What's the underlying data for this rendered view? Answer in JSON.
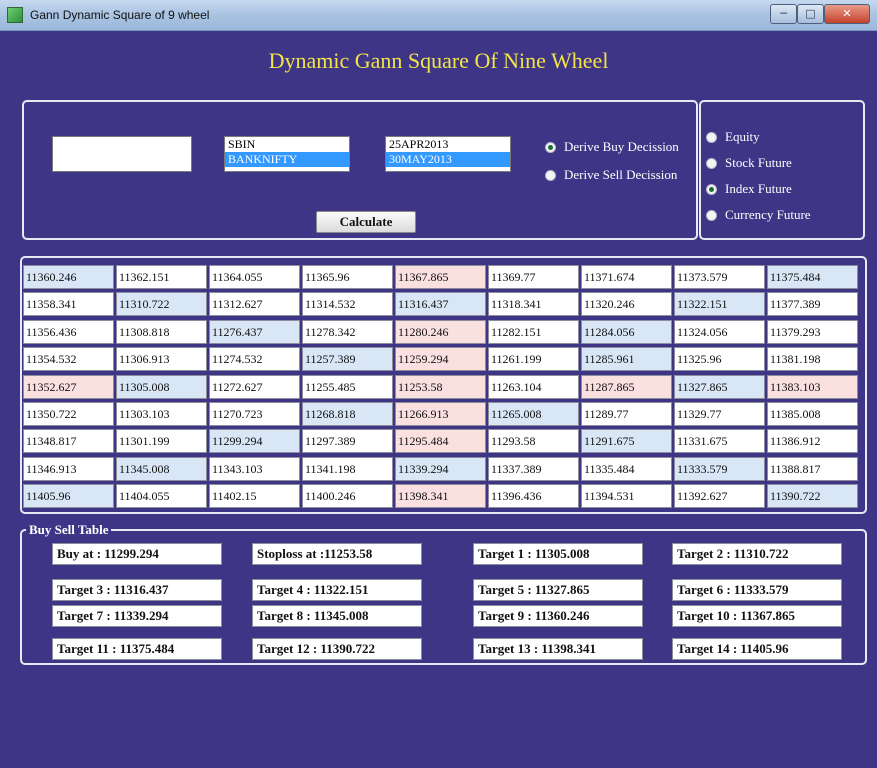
{
  "window": {
    "title": "Gann Dynamic Square of  9 wheel",
    "minimize": "─",
    "maximize": "□",
    "close": "✕",
    "icon": "app-icon"
  },
  "heading": "Dynamic Gann Square Of Nine Wheel",
  "inputs": {
    "value_input": ""
  },
  "symbols": [
    "SBIN",
    "BANKNIFTY"
  ],
  "dates": [
    "25APR2013",
    "30MAY2013"
  ],
  "decision": {
    "buy": "Derive Buy Decission",
    "sell": "Derive Sell Decission",
    "selected": "buy"
  },
  "calculate_label": "Calculate",
  "types": {
    "equity": "Equity",
    "stock_future": "Stock Future",
    "index_future": "Index Future",
    "currency_future": "Currency Future",
    "selected": "index_future"
  },
  "grid": [
    [
      "11360.246",
      "11362.151",
      "11364.055",
      "11365.96",
      "11367.865",
      "11369.77",
      "11371.674",
      "11373.579",
      "11375.484"
    ],
    [
      "11358.341",
      "11310.722",
      "11312.627",
      "11314.532",
      "11316.437",
      "11318.341",
      "11320.246",
      "11322.151",
      "11377.389"
    ],
    [
      "11356.436",
      "11308.818",
      "11276.437",
      "11278.342",
      "11280.246",
      "11282.151",
      "11284.056",
      "11324.056",
      "11379.293"
    ],
    [
      "11354.532",
      "11306.913",
      "11274.532",
      "11257.389",
      "11259.294",
      "11261.199",
      "11285.961",
      "11325.96",
      "11381.198"
    ],
    [
      "11352.627",
      "11305.008",
      "11272.627",
      "11255.485",
      "11253.58",
      "11263.104",
      "11287.865",
      "11327.865",
      "11383.103"
    ],
    [
      "11350.722",
      "11303.103",
      "11270.723",
      "11268.818",
      "11266.913",
      "11265.008",
      "11289.77",
      "11329.77",
      "11385.008"
    ],
    [
      "11348.817",
      "11301.199",
      "11299.294",
      "11297.389",
      "11295.484",
      "11293.58",
      "11291.675",
      "11331.675",
      "11386.912"
    ],
    [
      "11346.913",
      "11345.008",
      "11343.103",
      "11341.198",
      "11339.294",
      "11337.389",
      "11335.484",
      "11333.579",
      "11388.817"
    ],
    [
      "11405.96",
      "11404.055",
      "11402.15",
      "11400.246",
      "11398.341",
      "11396.436",
      "11394.531",
      "11392.627",
      "11390.722"
    ]
  ],
  "grid_colors": {
    "highlight_blue": "#d8e6f6",
    "highlight_pink": "#fbe0e0"
  },
  "buy_sell": {
    "legend": "Buy Sell Table",
    "buy_at": "Buy at : 11299.294",
    "stoploss": "Stoploss at :11253.58",
    "targets": [
      "Target 1 : 11305.008",
      "Target 2 : 11310.722",
      "Target 3 : 11316.437",
      "Target 4 : 11322.151",
      "Target 5 : 11327.865",
      "Target 6 : 11333.579",
      "Target 7 : 11339.294",
      "Target 8 : 11345.008",
      "Target 9 : 11360.246",
      "Target 10 : 11367.865",
      "Target 11 : 11375.484",
      "Target 12 : 11390.722",
      "Target 13 : 11398.341",
      "Target 14 : 11405.96"
    ]
  },
  "colors": {
    "background": "#3f3586",
    "heading": "#f1e34a"
  }
}
